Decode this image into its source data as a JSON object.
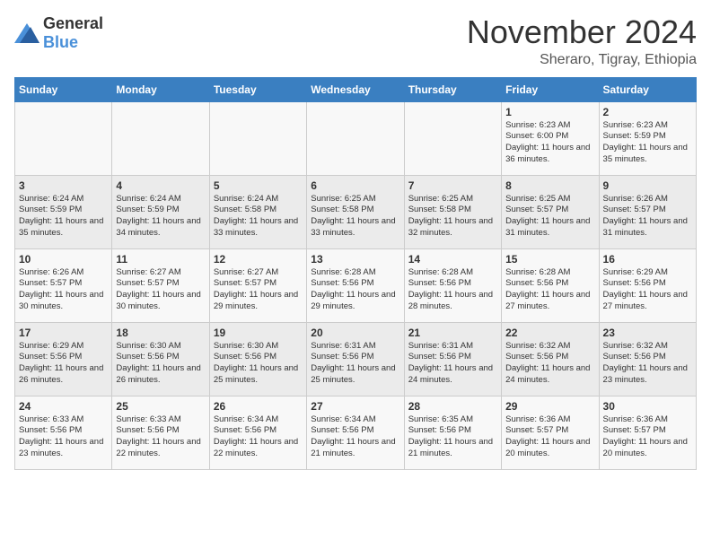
{
  "header": {
    "logo_general": "General",
    "logo_blue": "Blue",
    "month": "November 2024",
    "location": "Sheraro, Tigray, Ethiopia"
  },
  "days_of_week": [
    "Sunday",
    "Monday",
    "Tuesday",
    "Wednesday",
    "Thursday",
    "Friday",
    "Saturday"
  ],
  "weeks": [
    [
      {
        "day": "",
        "info": ""
      },
      {
        "day": "",
        "info": ""
      },
      {
        "day": "",
        "info": ""
      },
      {
        "day": "",
        "info": ""
      },
      {
        "day": "",
        "info": ""
      },
      {
        "day": "1",
        "info": "Sunrise: 6:23 AM\nSunset: 6:00 PM\nDaylight: 11 hours and 36 minutes."
      },
      {
        "day": "2",
        "info": "Sunrise: 6:23 AM\nSunset: 5:59 PM\nDaylight: 11 hours and 35 minutes."
      }
    ],
    [
      {
        "day": "3",
        "info": "Sunrise: 6:24 AM\nSunset: 5:59 PM\nDaylight: 11 hours and 35 minutes."
      },
      {
        "day": "4",
        "info": "Sunrise: 6:24 AM\nSunset: 5:59 PM\nDaylight: 11 hours and 34 minutes."
      },
      {
        "day": "5",
        "info": "Sunrise: 6:24 AM\nSunset: 5:58 PM\nDaylight: 11 hours and 33 minutes."
      },
      {
        "day": "6",
        "info": "Sunrise: 6:25 AM\nSunset: 5:58 PM\nDaylight: 11 hours and 33 minutes."
      },
      {
        "day": "7",
        "info": "Sunrise: 6:25 AM\nSunset: 5:58 PM\nDaylight: 11 hours and 32 minutes."
      },
      {
        "day": "8",
        "info": "Sunrise: 6:25 AM\nSunset: 5:57 PM\nDaylight: 11 hours and 31 minutes."
      },
      {
        "day": "9",
        "info": "Sunrise: 6:26 AM\nSunset: 5:57 PM\nDaylight: 11 hours and 31 minutes."
      }
    ],
    [
      {
        "day": "10",
        "info": "Sunrise: 6:26 AM\nSunset: 5:57 PM\nDaylight: 11 hours and 30 minutes."
      },
      {
        "day": "11",
        "info": "Sunrise: 6:27 AM\nSunset: 5:57 PM\nDaylight: 11 hours and 30 minutes."
      },
      {
        "day": "12",
        "info": "Sunrise: 6:27 AM\nSunset: 5:57 PM\nDaylight: 11 hours and 29 minutes."
      },
      {
        "day": "13",
        "info": "Sunrise: 6:28 AM\nSunset: 5:56 PM\nDaylight: 11 hours and 29 minutes."
      },
      {
        "day": "14",
        "info": "Sunrise: 6:28 AM\nSunset: 5:56 PM\nDaylight: 11 hours and 28 minutes."
      },
      {
        "day": "15",
        "info": "Sunrise: 6:28 AM\nSunset: 5:56 PM\nDaylight: 11 hours and 27 minutes."
      },
      {
        "day": "16",
        "info": "Sunrise: 6:29 AM\nSunset: 5:56 PM\nDaylight: 11 hours and 27 minutes."
      }
    ],
    [
      {
        "day": "17",
        "info": "Sunrise: 6:29 AM\nSunset: 5:56 PM\nDaylight: 11 hours and 26 minutes."
      },
      {
        "day": "18",
        "info": "Sunrise: 6:30 AM\nSunset: 5:56 PM\nDaylight: 11 hours and 26 minutes."
      },
      {
        "day": "19",
        "info": "Sunrise: 6:30 AM\nSunset: 5:56 PM\nDaylight: 11 hours and 25 minutes."
      },
      {
        "day": "20",
        "info": "Sunrise: 6:31 AM\nSunset: 5:56 PM\nDaylight: 11 hours and 25 minutes."
      },
      {
        "day": "21",
        "info": "Sunrise: 6:31 AM\nSunset: 5:56 PM\nDaylight: 11 hours and 24 minutes."
      },
      {
        "day": "22",
        "info": "Sunrise: 6:32 AM\nSunset: 5:56 PM\nDaylight: 11 hours and 24 minutes."
      },
      {
        "day": "23",
        "info": "Sunrise: 6:32 AM\nSunset: 5:56 PM\nDaylight: 11 hours and 23 minutes."
      }
    ],
    [
      {
        "day": "24",
        "info": "Sunrise: 6:33 AM\nSunset: 5:56 PM\nDaylight: 11 hours and 23 minutes."
      },
      {
        "day": "25",
        "info": "Sunrise: 6:33 AM\nSunset: 5:56 PM\nDaylight: 11 hours and 22 minutes."
      },
      {
        "day": "26",
        "info": "Sunrise: 6:34 AM\nSunset: 5:56 PM\nDaylight: 11 hours and 22 minutes."
      },
      {
        "day": "27",
        "info": "Sunrise: 6:34 AM\nSunset: 5:56 PM\nDaylight: 11 hours and 21 minutes."
      },
      {
        "day": "28",
        "info": "Sunrise: 6:35 AM\nSunset: 5:56 PM\nDaylight: 11 hours and 21 minutes."
      },
      {
        "day": "29",
        "info": "Sunrise: 6:36 AM\nSunset: 5:57 PM\nDaylight: 11 hours and 20 minutes."
      },
      {
        "day": "30",
        "info": "Sunrise: 6:36 AM\nSunset: 5:57 PM\nDaylight: 11 hours and 20 minutes."
      }
    ]
  ]
}
